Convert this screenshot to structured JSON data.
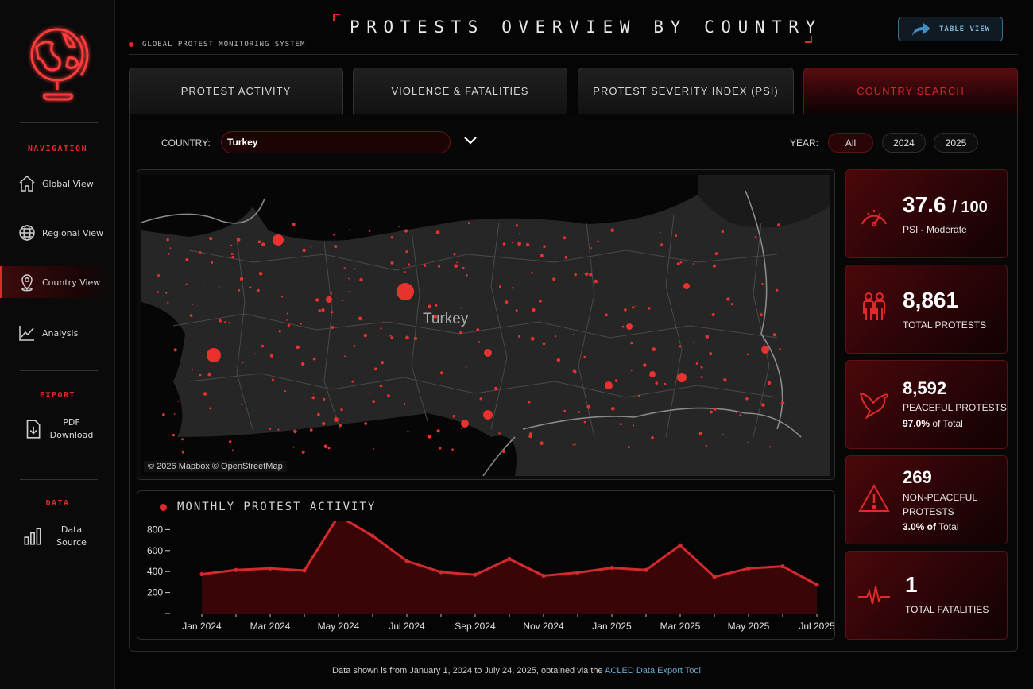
{
  "header": {
    "title": "PROTESTS OVERVIEW BY COUNTRY",
    "subtitle": "GLOBAL PROTEST MONITORING SYSTEM",
    "table_view_label": "TABLE VIEW"
  },
  "sidebar": {
    "navigation_heading": "NAVIGATION",
    "nav_items": [
      {
        "label": "Global View",
        "icon": "home-icon"
      },
      {
        "label": "Regional View",
        "icon": "globe-icon"
      },
      {
        "label": "Country View",
        "icon": "location-pin-icon",
        "active": true
      },
      {
        "label": "Analysis",
        "icon": "line-chart-icon"
      }
    ],
    "export_heading": "EXPORT",
    "export_item": {
      "label_line1": "PDF",
      "label_line2": "Download",
      "icon": "download-document-icon"
    },
    "data_heading": "DATA",
    "data_item": {
      "label_line1": "Data",
      "label_line2": "Source",
      "icon": "bar-chart-icon"
    }
  },
  "tabs": [
    {
      "label": "PROTEST ACTIVITY"
    },
    {
      "label": "VIOLENCE & FATALITIES"
    },
    {
      "label": "PROTEST SEVERITY INDEX (PSI)"
    },
    {
      "label": "COUNTRY SEARCH",
      "active": true
    }
  ],
  "filters": {
    "country_label": "COUNTRY:",
    "country_value": "Turkey",
    "year_label": "YEAR:",
    "year_options": [
      "All",
      "2024",
      "2025"
    ],
    "year_selected": "All"
  },
  "map": {
    "country_name": "Turkey",
    "attribution": "© 2026 Mapbox © OpenStreetMap"
  },
  "chart": {
    "title": "MONTHLY PROTEST ACTIVITY"
  },
  "chart_data": {
    "type": "area",
    "title": "MONTHLY PROTEST ACTIVITY",
    "x": [
      "Jan 2024",
      "Feb 2024",
      "Mar 2024",
      "Apr 2024",
      "May 2024",
      "Jun 2024",
      "Jul 2024",
      "Aug 2024",
      "Sep 2024",
      "Oct 2024",
      "Nov 2024",
      "Dec 2024",
      "Jan 2025",
      "Feb 2025",
      "Mar 2025",
      "Apr 2025",
      "May 2025",
      "Jun 2025",
      "Jul 2025"
    ],
    "x_tick_labels": [
      "Jan 2024",
      "Mar 2024",
      "May 2024",
      "Jul 2024",
      "Sep 2024",
      "Nov 2024",
      "Jan 2025",
      "Mar 2025",
      "May 2025",
      "Jul 2025"
    ],
    "values": [
      375,
      415,
      430,
      410,
      930,
      740,
      500,
      395,
      370,
      520,
      360,
      390,
      435,
      415,
      650,
      350,
      430,
      450,
      275
    ],
    "y_ticks": [
      200,
      400,
      600,
      800
    ],
    "y_tick_labels": [
      "200",
      "400",
      "600",
      "800"
    ],
    "ylim": [
      0,
      1000
    ],
    "colors": {
      "line": "#d42a2d",
      "fill": "#3a0507"
    }
  },
  "kpis": {
    "psi": {
      "value": "37.6",
      "suffix": "/ 100",
      "label": "PSI - Moderate",
      "icon": "speedometer-icon"
    },
    "total": {
      "value": "8,861",
      "label": "TOTAL PROTESTS",
      "icon": "people-icon"
    },
    "peaceful": {
      "value": "8,592",
      "label": "PEACEFUL PROTESTS",
      "pct": "97.0%",
      "pct_suffix": " of Total",
      "icon": "dove-icon"
    },
    "nonpeaceful": {
      "value": "269",
      "label_line1": "NON-PEACEFUL",
      "label_line2": "PROTESTS",
      "pct": "3.0% of",
      "pct_suffix": " Total",
      "icon": "warning-icon"
    },
    "fatalities": {
      "value": "1",
      "label": "TOTAL FATALITIES",
      "icon": "heartbeat-icon"
    }
  },
  "footer": {
    "text": "Data shown is from January 1, 2024 to July 24, 2025, obtained via the ",
    "link": "ACLED Data Export Tool"
  },
  "colors": {
    "accent": "#e0292b",
    "card_bg": "#2a0407",
    "link": "#6fa7cc"
  }
}
